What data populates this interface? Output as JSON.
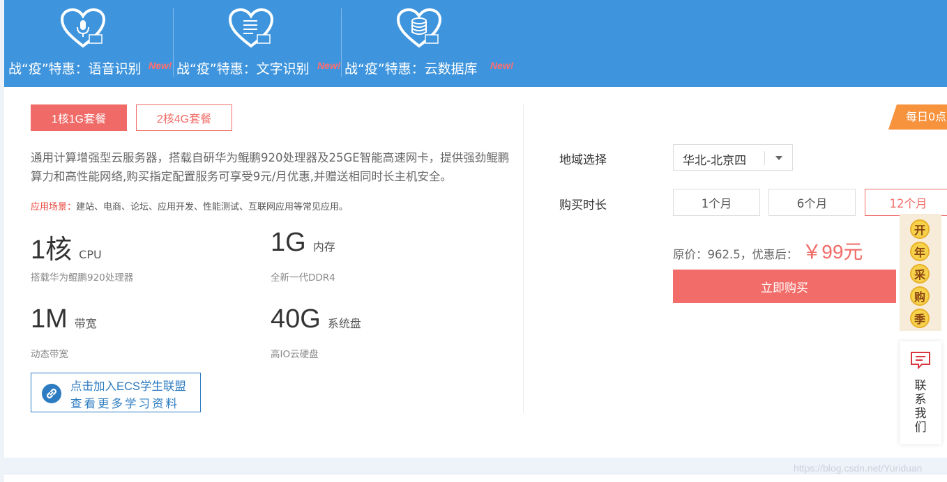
{
  "promos": [
    {
      "label": "战“疫”特惠：语音识别",
      "new": "New!",
      "icon": "heart-mic-icon"
    },
    {
      "label": "战“疫”特惠：文字识别",
      "new": "New!",
      "icon": "heart-document-icon"
    },
    {
      "label": "战“疫”特惠：云数据库",
      "new": "New!",
      "icon": "heart-database-icon"
    }
  ],
  "packages": [
    {
      "label": "1核1G套餐",
      "active": true
    },
    {
      "label": "2核4G套餐",
      "active": false
    }
  ],
  "description": "通用计算增强型云服务器，搭载自研华为鲲鹏920处理器及25GE智能高速网卡，提供强劲鲲鹏算力和高性能网络,购买指定配置服务可享受9元/月优惠,并赠送相同时长主机安全。",
  "scene": {
    "label": "应用场景：",
    "text": "建站、电商、论坛、应用开发、性能测试、互联网应用等常见应用。"
  },
  "specs": [
    {
      "value": "1核",
      "unit": "CPU",
      "sub": "搭载华为鲲鹏920处理器"
    },
    {
      "value": "1G",
      "unit": "内存",
      "sub": "全新一代DDR4"
    },
    {
      "value": "1M",
      "unit": "带宽",
      "sub": "动态带宽"
    },
    {
      "value": "40G",
      "unit": "系统盘",
      "sub": "高IO云硬盘"
    }
  ],
  "ecs": {
    "line1": "点击加入ECS学生联盟",
    "line2": "查看更多学习资料",
    "icon": "link-icon"
  },
  "badge": "每日0点",
  "region": {
    "label": "地域选择",
    "value": "华北-北京四"
  },
  "duration": {
    "label": "购买时长",
    "options": [
      "1个月",
      "6个月",
      "12个月"
    ],
    "selected": "12个月"
  },
  "price": {
    "original_label": "原价：962.5，优惠后：",
    "sale": "￥99元"
  },
  "buy_label": "立即购买",
  "float_banner": {
    "chars": [
      "开",
      "年",
      "采",
      "购",
      "季"
    ]
  },
  "contact": {
    "label": "联系我们",
    "icon": "chat-icon"
  },
  "watermark": "https://blog.csdn.net/Yuriduan",
  "colors": {
    "topbar": "#3f95dd",
    "accent": "#f06b67",
    "link": "#2d7cc1",
    "badge": "#f7923d"
  }
}
